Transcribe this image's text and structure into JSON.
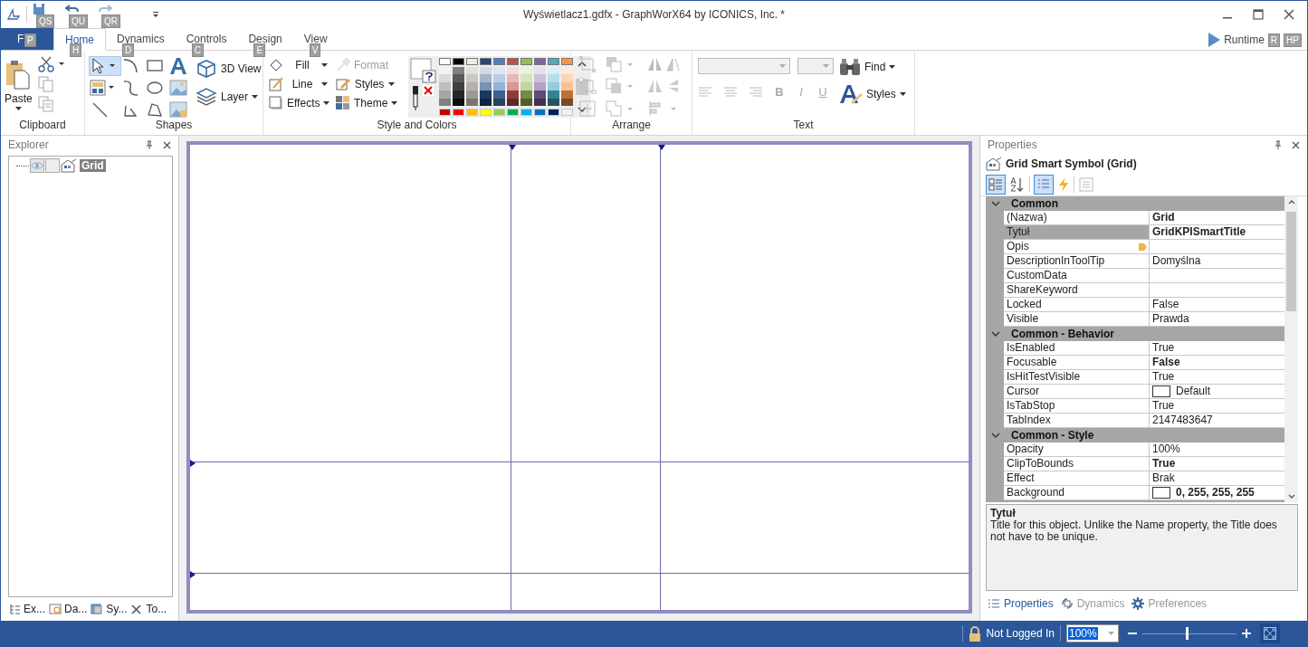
{
  "window": {
    "title": "Wyświetlacz1.gdfx - GraphWorX64 by ICONICS, Inc. *"
  },
  "quick_access": [
    {
      "kind": "save",
      "keytip": "QS",
      "disabled": false
    },
    {
      "kind": "undo",
      "keytip": "QU",
      "disabled": false
    },
    {
      "kind": "redo",
      "keytip": "QR",
      "disabled": true
    }
  ],
  "tabs": [
    {
      "label": "F",
      "keytip": "P",
      "kind": "file",
      "selected": false
    },
    {
      "label": "Home",
      "keytip": "H",
      "kind": "tab",
      "selected": true
    },
    {
      "label": "Dynamics",
      "keytip": "D",
      "kind": "tab",
      "selected": false
    },
    {
      "label": "Controls",
      "keytip": "C",
      "kind": "tab",
      "selected": false
    },
    {
      "label": "Design",
      "keytip": "E",
      "kind": "tab",
      "selected": false
    },
    {
      "label": "View",
      "keytip": "V",
      "kind": "tab",
      "selected": false
    }
  ],
  "runtime": {
    "label": "Runtime",
    "keytip": "R",
    "help_keytip": "HP"
  },
  "ribbon": {
    "clipboard": {
      "title": "Clipboard",
      "paste": "Paste"
    },
    "shapes": {
      "title": "Shapes",
      "view3d": "3D View",
      "layer": "Layer"
    },
    "style": {
      "title": "Style and Colors",
      "buttons": [
        {
          "kind": "fill",
          "label": "Fill",
          "disabled": false
        },
        {
          "kind": "format",
          "label": "Format",
          "disabled": true
        },
        {
          "kind": "line",
          "label": "Line",
          "disabled": false
        },
        {
          "kind": "styles",
          "label": "Styles",
          "disabled": false
        },
        {
          "kind": "effects",
          "label": "Effects",
          "disabled": false
        },
        {
          "kind": "theme",
          "label": "Theme",
          "disabled": false
        }
      ],
      "palette": [
        {
          "color": "#ffffff"
        },
        {
          "color": "#000000"
        },
        {
          "color": "#eeece1"
        },
        {
          "color": "#1f497d"
        },
        {
          "color": "#4f81bd"
        },
        {
          "color": "#c0504d"
        },
        {
          "color": "#9bbb59"
        },
        {
          "color": "#8064a2"
        },
        {
          "color": "#4bacc6"
        },
        {
          "color": "#f79646"
        }
      ],
      "standard": [
        {
          "color": "#c00000"
        },
        {
          "color": "#ff0000"
        },
        {
          "color": "#ffc000"
        },
        {
          "color": "#ffff00"
        },
        {
          "color": "#92d050"
        },
        {
          "color": "#00b050"
        },
        {
          "color": "#00b0f0"
        },
        {
          "color": "#0070c0"
        },
        {
          "color": "#002060"
        },
        {
          "color": "#f0f0f0"
        }
      ]
    },
    "arrange": {
      "title": "Arrange"
    },
    "text": {
      "title": "Text",
      "find": "Find",
      "styles": "Styles",
      "bold": "B",
      "italic": "I",
      "underline": "U"
    }
  },
  "explorer": {
    "title": "Explorer",
    "tree": [
      {
        "label": "Grid",
        "selected": true
      }
    ],
    "tabs": [
      {
        "kind": "explorer",
        "label": "Ex..."
      },
      {
        "kind": "data",
        "label": "Da..."
      },
      {
        "kind": "symbols",
        "label": "Sy..."
      },
      {
        "kind": "tools",
        "label": "To..."
      }
    ]
  },
  "properties": {
    "title": "Properties",
    "object": "Grid Smart Symbol (Grid)",
    "categories": [
      {
        "name": "Common",
        "expanded": true,
        "rows": [
          {
            "name": "(Nazwa)",
            "value": "Grid",
            "bold": true,
            "kind": "text",
            "selected": false
          },
          {
            "name": "Tytuł",
            "value": "GridKPISmartTitle",
            "bold": true,
            "kind": "text",
            "selected": true
          },
          {
            "name": "Opis",
            "kind": "tag",
            "selected": false
          },
          {
            "name": "DescriptionInToolTip",
            "value": "Domyślna",
            "bold": false,
            "kind": "text",
            "selected": false
          },
          {
            "name": "CustomData",
            "kind": "text",
            "selected": false
          },
          {
            "name": "ShareKeyword",
            "kind": "text",
            "selected": false
          },
          {
            "name": "Locked",
            "value": "False",
            "bold": false,
            "kind": "text",
            "selected": false
          },
          {
            "name": "Visible",
            "value": "Prawda",
            "bold": false,
            "kind": "text",
            "selected": false
          }
        ]
      },
      {
        "name": "Common - Behavior",
        "expanded": true,
        "rows": [
          {
            "name": "IsEnabled",
            "value": "True",
            "bold": false,
            "kind": "text",
            "selected": false
          },
          {
            "name": "Focusable",
            "value": "False",
            "bold": true,
            "kind": "text",
            "selected": false
          },
          {
            "name": "IsHitTestVisible",
            "value": "True",
            "bold": false,
            "kind": "text",
            "selected": false
          },
          {
            "name": "Cursor",
            "value": "Default",
            "bold": false,
            "kind": "swatch",
            "selected": false
          },
          {
            "name": "IsTabStop",
            "value": "True",
            "bold": false,
            "kind": "text",
            "selected": false
          },
          {
            "name": "TabIndex",
            "value": "2147483647",
            "bold": false,
            "kind": "text",
            "selected": false
          }
        ]
      },
      {
        "name": "Common - Style",
        "expanded": true,
        "rows": [
          {
            "name": "Opacity",
            "value": "100%",
            "bold": false,
            "kind": "text",
            "selected": false
          },
          {
            "name": "ClipToBounds",
            "value": "True",
            "bold": true,
            "kind": "text",
            "selected": false
          },
          {
            "name": "Effect",
            "value": "Brak",
            "bold": false,
            "kind": "text",
            "selected": false
          },
          {
            "name": "Background",
            "value": "0, 255, 255, 255",
            "bold": true,
            "kind": "swatch",
            "selected": false
          }
        ]
      }
    ],
    "description": {
      "title": "Tytuł",
      "text": "Title for this object.  Unlike the Name property, the Title does not have to be unique."
    },
    "tabs": [
      {
        "kind": "properties",
        "label": "Properties",
        "selected": true
      },
      {
        "kind": "dynamics",
        "label": "Dynamics",
        "selected": false
      },
      {
        "kind": "preferences",
        "label": "Preferences",
        "selected": false
      }
    ]
  },
  "status": {
    "user": "Not Logged In",
    "zoom": "100%",
    "level": 0.47
  }
}
